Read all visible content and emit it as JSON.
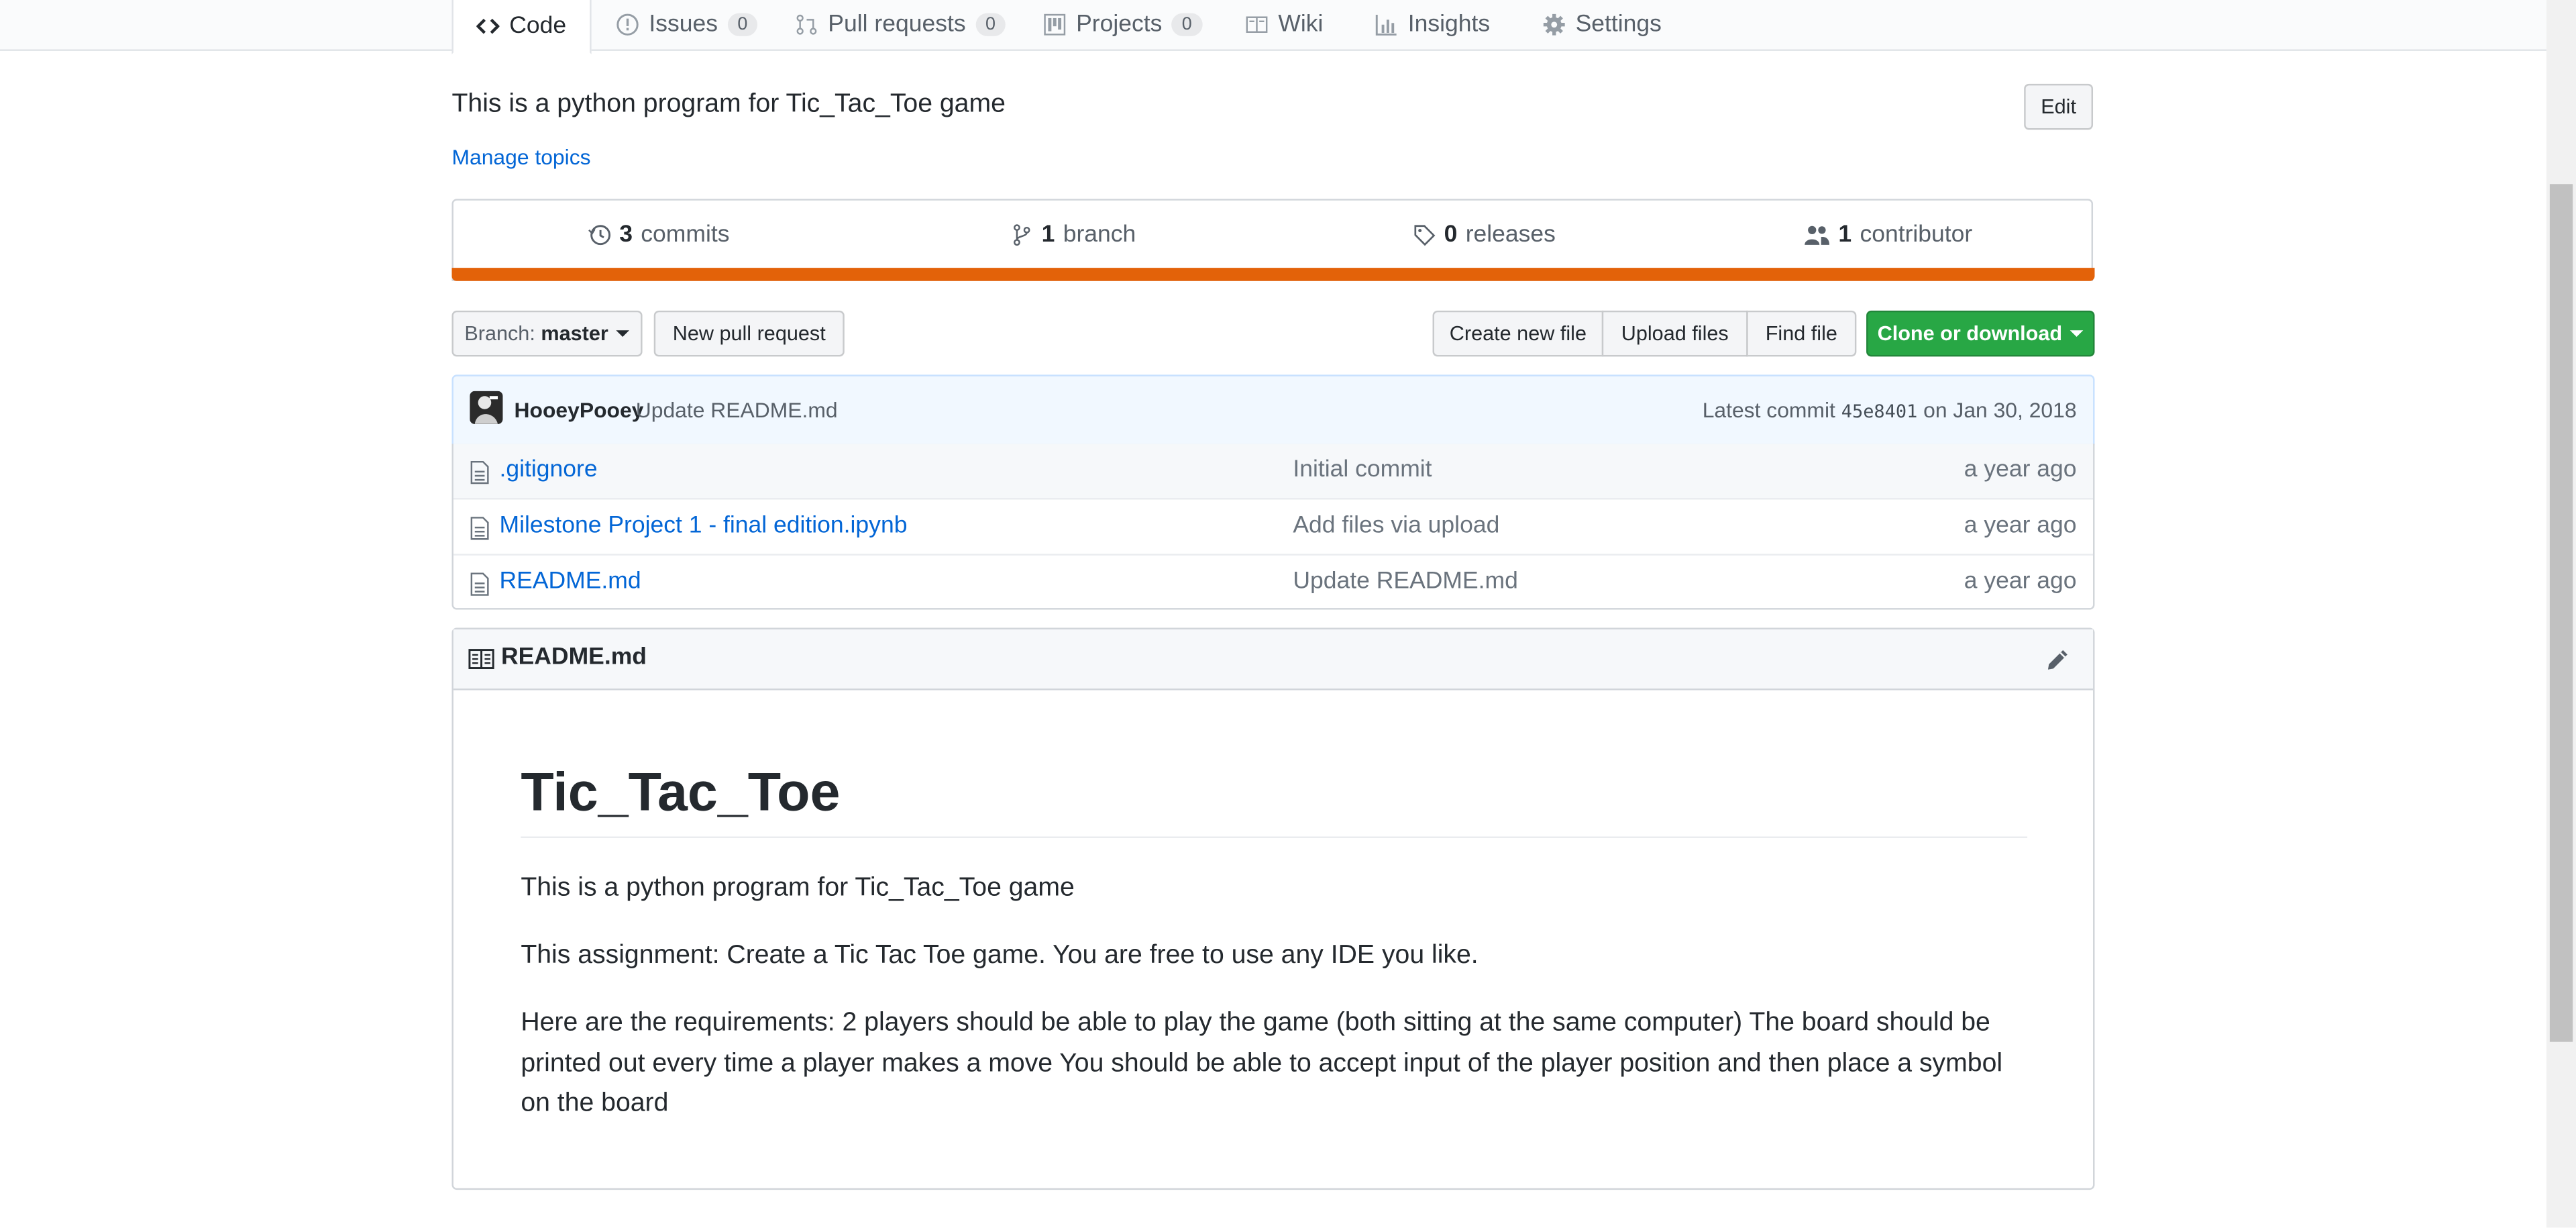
{
  "tabs": [
    {
      "label": "Code"
    },
    {
      "label": "Issues",
      "count": "0"
    },
    {
      "label": "Pull requests",
      "count": "0"
    },
    {
      "label": "Projects",
      "count": "0"
    },
    {
      "label": "Wiki"
    },
    {
      "label": "Insights"
    },
    {
      "label": "Settings"
    }
  ],
  "repo": {
    "description": "This is a python program for Tic_Tac_Toe game",
    "edit_label": "Edit",
    "manage_topics": "Manage topics"
  },
  "summary": {
    "commits_count": "3",
    "commits_label": "commits",
    "branch_count": "1",
    "branch_label": "branch",
    "releases_count": "0",
    "releases_label": "releases",
    "contributor_count": "1",
    "contributor_label": "contributor",
    "language_color": "#e36209"
  },
  "toolbar": {
    "branch_prefix": "Branch:",
    "branch_name": "master",
    "new_pull_request": "New pull request",
    "create_new_file": "Create new file",
    "upload_files": "Upload files",
    "find_file": "Find file",
    "clone_or_download": "Clone or download"
  },
  "latest_commit": {
    "author": "HooeyPooey",
    "message": "Update README.md",
    "prefix": "Latest commit",
    "sha": "45e8401",
    "date": "on Jan 30, 2018"
  },
  "files": [
    {
      "name": ".gitignore",
      "message": "Initial commit",
      "age": "a year ago"
    },
    {
      "name": "Milestone Project 1 - final edition.ipynb",
      "message": "Add files via upload",
      "age": "a year ago"
    },
    {
      "name": "README.md",
      "message": "Update README.md",
      "age": "a year ago"
    }
  ],
  "readme": {
    "filename": "README.md",
    "title": "Tic_Tac_Toe",
    "paragraphs": [
      "This is a python program for Tic_Tac_Toe game",
      "This assignment: Create a Tic Tac Toe game. You are free to use any IDE you like.",
      "Here are the requirements: 2 players should be able to play the game (both sitting at the same computer) The board should be printed out every time a player makes a move You should be able to accept input of the player position and then place a symbol on the board"
    ]
  }
}
